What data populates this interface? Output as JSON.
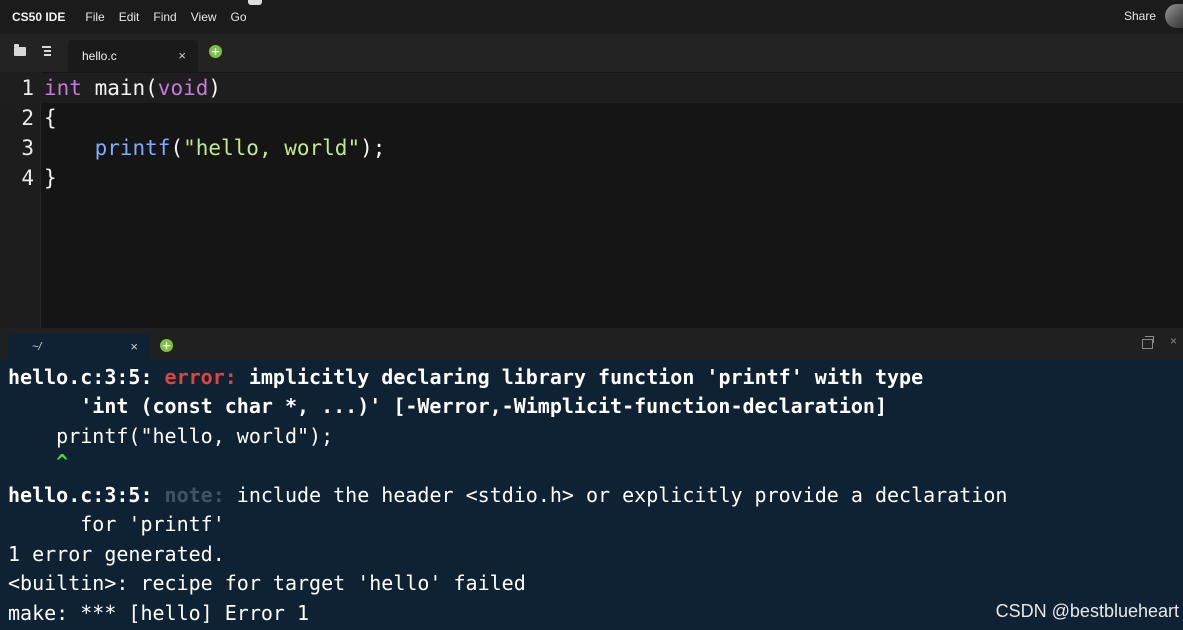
{
  "app": {
    "name": "CS50 IDE"
  },
  "menu": {
    "items": [
      "File",
      "Edit",
      "Find",
      "View",
      "Go"
    ],
    "share_label": "Share"
  },
  "editor": {
    "tab": {
      "label": "hello.c",
      "close": "×"
    },
    "add_tab": "+",
    "lines": [
      {
        "num": "1",
        "tokens": [
          {
            "t": "int",
            "c": "kw"
          },
          {
            "t": " main(",
            "c": ""
          },
          {
            "t": "void",
            "c": "kw"
          },
          {
            "t": ")",
            "c": ""
          }
        ]
      },
      {
        "num": "2",
        "tokens": [
          {
            "t": "{",
            "c": ""
          }
        ]
      },
      {
        "num": "3",
        "tokens": [
          {
            "t": "    ",
            "c": ""
          },
          {
            "t": "printf",
            "c": "fn"
          },
          {
            "t": "(",
            "c": ""
          },
          {
            "t": "\"hello, world\"",
            "c": "str"
          },
          {
            "t": ");",
            "c": ""
          }
        ]
      },
      {
        "num": "4",
        "tokens": [
          {
            "t": "}",
            "c": ""
          }
        ]
      }
    ]
  },
  "terminal": {
    "tab": {
      "label": "~/",
      "close": "×"
    },
    "add_tab": "+",
    "close_panel": "×",
    "lines": [
      [
        {
          "t": "hello.c:3:5: ",
          "c": "b"
        },
        {
          "t": "error: ",
          "c": "err"
        },
        {
          "t": "implicitly declaring library function 'printf' with type",
          "c": "b"
        }
      ],
      [
        {
          "t": "      'int (const char *, ...)' [-Werror,-Wimplicit-function-declaration]",
          "c": "b"
        }
      ],
      [
        {
          "t": "    printf(\"hello, world\");",
          "c": ""
        }
      ],
      [
        {
          "t": "    ^",
          "c": "caret"
        }
      ],
      [
        {
          "t": "hello.c:3:5: ",
          "c": "b"
        },
        {
          "t": "note: ",
          "c": "note"
        },
        {
          "t": "include the header <stdio.h> or explicitly provide a declaration",
          "c": ""
        }
      ],
      [
        {
          "t": "      for 'printf'",
          "c": ""
        }
      ],
      [
        {
          "t": "1 error generated.",
          "c": ""
        }
      ],
      [
        {
          "t": "<builtin>: recipe for target 'hello' failed",
          "c": ""
        }
      ],
      [
        {
          "t": "make: *** [hello] Error 1",
          "c": ""
        }
      ]
    ]
  },
  "watermark": "CSDN @bestblueheart",
  "colors": {
    "keyword": "#c678dd",
    "function": "#82aaff",
    "string": "#c3e88d",
    "error": "#e0443e",
    "note": "#3f5566",
    "caret": "#4bd44b",
    "terminal_bg": "#0e2233",
    "add_button": "#7bc142"
  }
}
